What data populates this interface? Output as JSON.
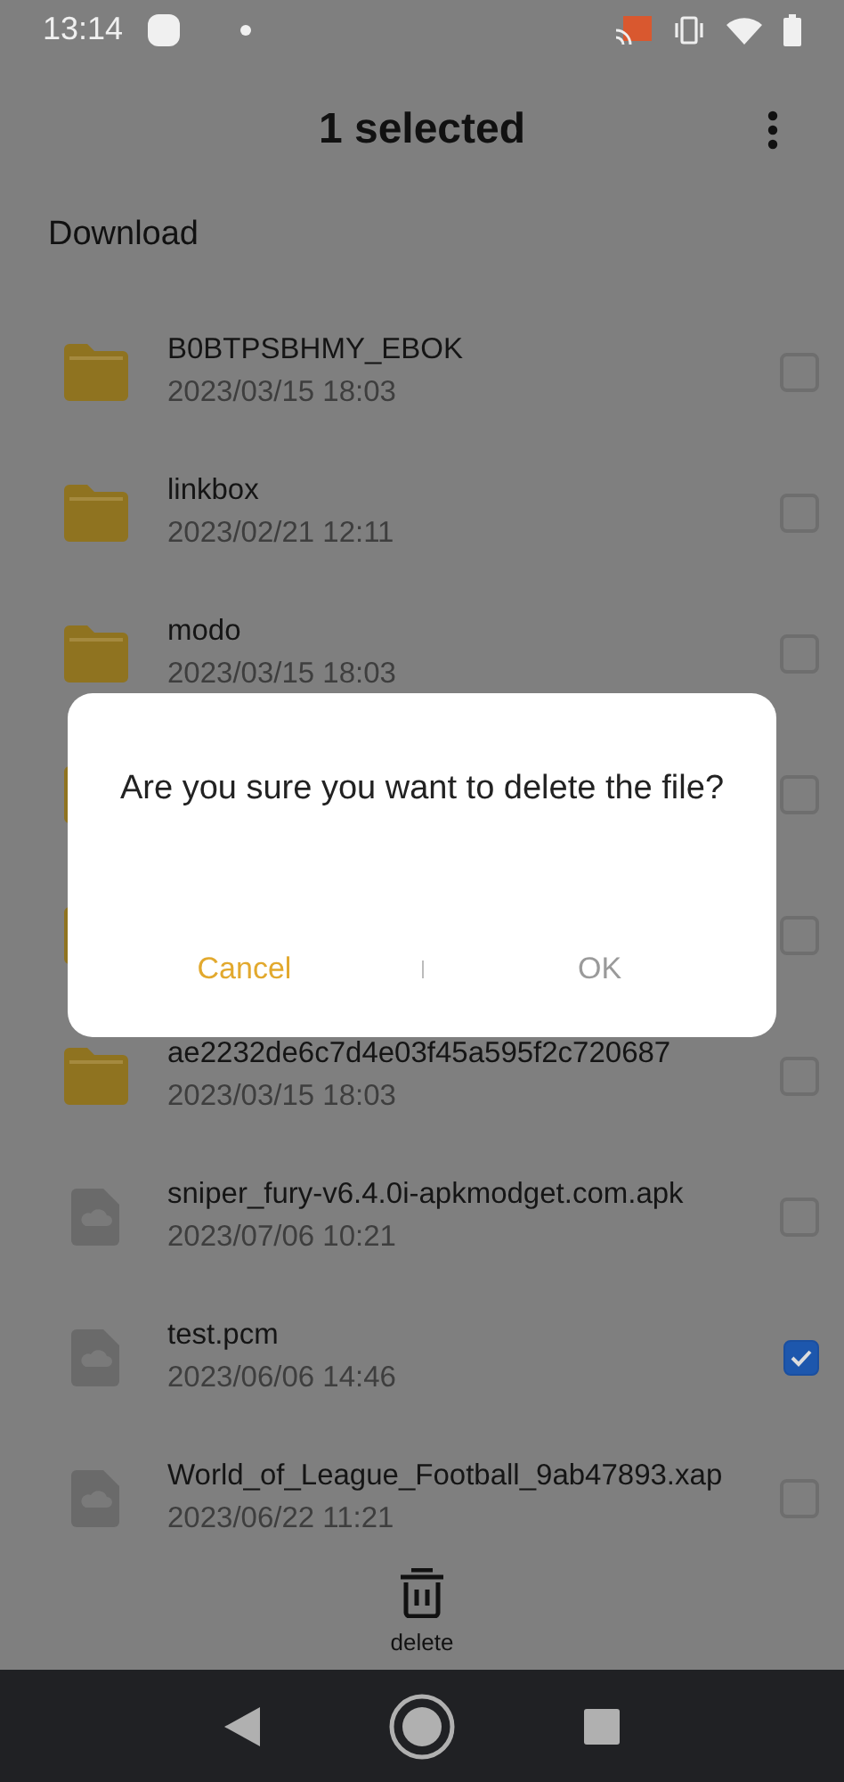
{
  "status_bar": {
    "time": "13:14"
  },
  "toolbar": {
    "title": "1 selected"
  },
  "path": "Download",
  "files": [
    {
      "kind": "folder",
      "name": "B0BTPSBHMY_EBOK",
      "date": "2023/03/15 18:03",
      "checked": false
    },
    {
      "kind": "folder",
      "name": "linkbox",
      "date": "2023/02/21 12:11",
      "checked": false
    },
    {
      "kind": "folder",
      "name": "modo",
      "date": "2023/03/15 18:03",
      "checked": false
    },
    {
      "kind": "folder",
      "checked": false
    },
    {
      "kind": "folder",
      "checked": false
    },
    {
      "kind": "folder",
      "name": "ae2232de6c7d4e03f45a595f2c720687",
      "date": "2023/03/15 18:03",
      "checked": false
    },
    {
      "kind": "file",
      "name": "sniper_fury-v6.4.0i-apkmodget.com.apk",
      "date": "2023/07/06 10:21",
      "checked": false
    },
    {
      "kind": "file",
      "name": "test.pcm",
      "date": "2023/06/06 14:46",
      "checked": true
    },
    {
      "kind": "file",
      "name": "World_of_League_Football_9ab47893.xap",
      "date": "2023/06/22 11:21",
      "checked": false
    }
  ],
  "bottom_action": {
    "label": "delete"
  },
  "dialog": {
    "message": "Are you sure you want to delete the file?",
    "buttons": [
      {
        "label": "Cancel",
        "disabled": false
      },
      {
        "label": "OK",
        "disabled": true
      }
    ]
  }
}
